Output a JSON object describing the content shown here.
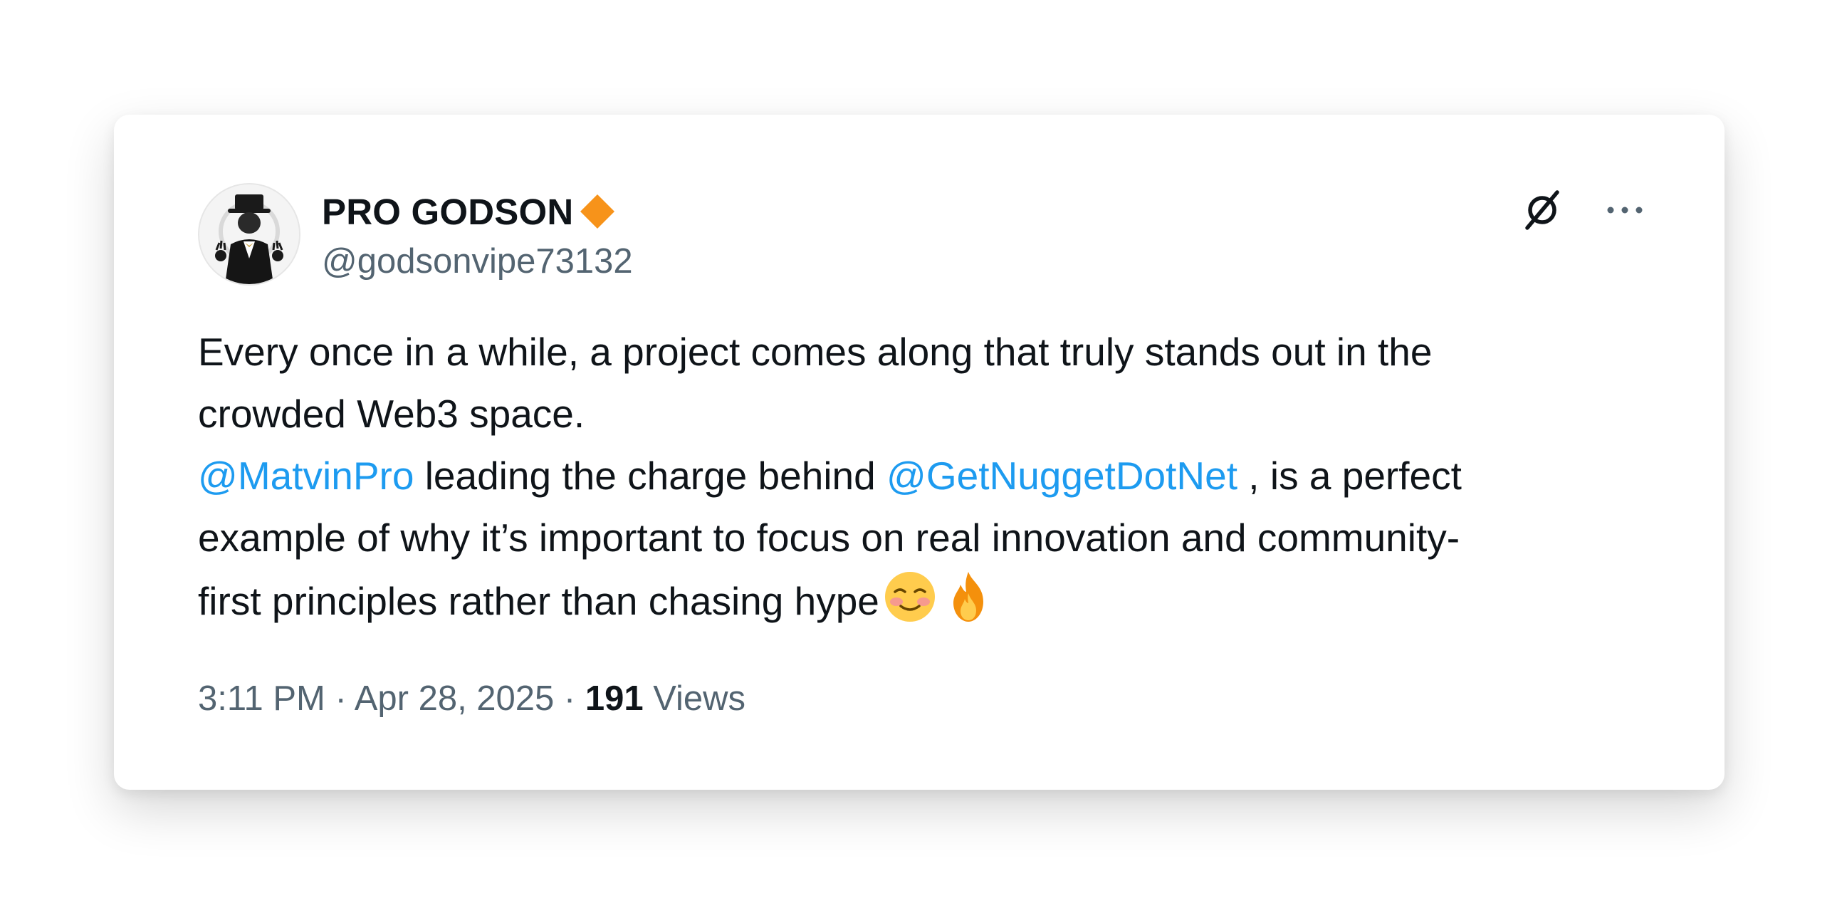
{
  "author": {
    "display_name": "PRO GODSON",
    "handle": "@godsonvipe73132",
    "badge_color": "#f7931a",
    "avatar_icon": "tuxedo-man-avatar"
  },
  "actions": {
    "grok_icon": "grok-icon",
    "more_icon": "more-icon"
  },
  "tweet": {
    "line1": "Every once in a while, a project comes along that truly stands out in the",
    "line2": "crowded Web3 space.",
    "mention1": "@MatvinPro",
    "text3a": " leading the charge behind ",
    "mention2": "@GetNuggetDotNet",
    "text3b": " , is a perfect",
    "line4": "example of why it’s important to focus on real innovation and community-",
    "line5": "first principles rather than chasing hype",
    "emoji1": "smiling-face-emoji",
    "emoji2": "fire-emoji"
  },
  "meta": {
    "time": "3:11 PM",
    "sep1": " · ",
    "date": "Apr 28, 2025",
    "sep2": " · ",
    "views_count": "191",
    "views_label": " Views"
  },
  "colors": {
    "text": "#0f1419",
    "secondary": "#536471",
    "link": "#1d9bf0"
  }
}
